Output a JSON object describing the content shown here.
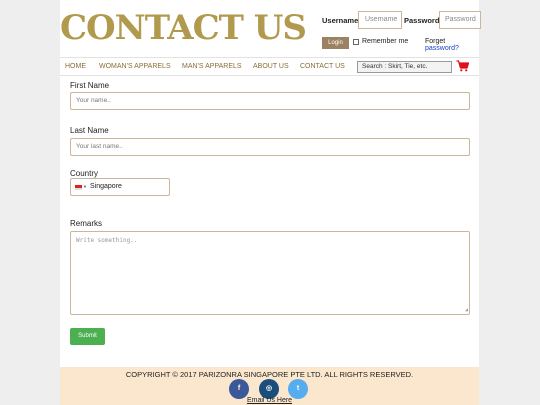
{
  "header": {
    "logo_text": "CONTACT US",
    "username_label": "Username",
    "username_placeholder": "Username",
    "password_label": "Password",
    "password_placeholder": "Password",
    "login_label": "Login",
    "remember_label": "Remember me",
    "forget_prefix": "Forget",
    "forget_link": "password?"
  },
  "nav": {
    "items": [
      "HOME",
      "WOMAN'S APPARELS",
      "MAN'S APPARELS",
      "ABOUT US",
      "CONTACT US"
    ],
    "search_placeholder": "Search :   Skirt, Tie, etc."
  },
  "form": {
    "first_name_label": "First Name",
    "first_name_placeholder": "Your name..",
    "last_name_label": "Last Name",
    "last_name_placeholder": "Your last name..",
    "country_label": "Country",
    "country_value": "Singapore",
    "remarks_label": "Remarks",
    "remarks_placeholder": "Write something..",
    "submit_label": "Submit"
  },
  "footer": {
    "copyright": "COPYRIGHT © 2017 PARIZONRA SINGAPORE PTE LTD. ALL RIGHTS RESERVED.",
    "social": [
      {
        "glyph": "f",
        "icon": "facebook-icon",
        "color": "#3b5998"
      },
      {
        "glyph": "◎",
        "icon": "instagram-icon",
        "color": "#1b4e7a"
      },
      {
        "glyph": "t",
        "icon": "twitter-icon",
        "color": "#55acee"
      }
    ],
    "email_link": "Email Us Here"
  },
  "colors": {
    "brand": "#b19a4e",
    "nav_text": "#8a6d35",
    "login_button": "#9b8262",
    "submit_button": "#4caf50",
    "footer_bg": "#fbe7cd",
    "cart": "#e0101a"
  }
}
